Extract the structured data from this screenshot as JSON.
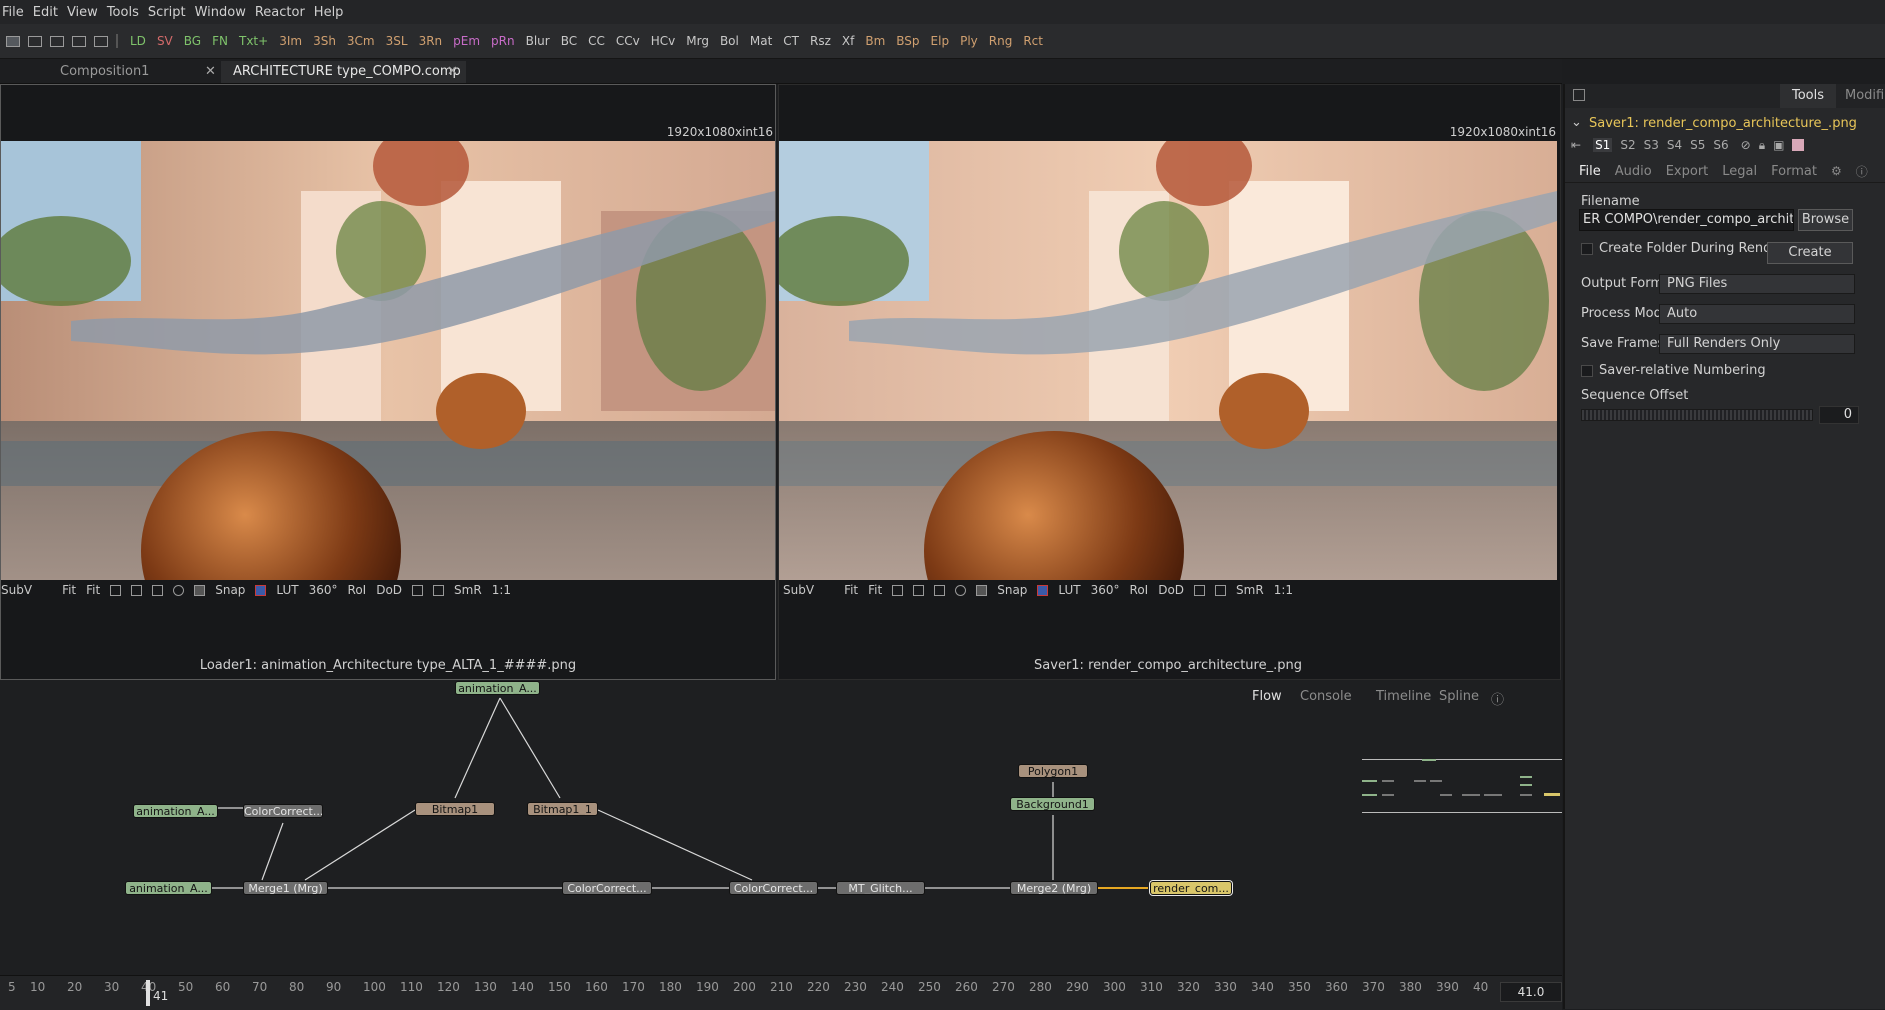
{
  "menu": [
    "File",
    "Edit",
    "View",
    "Tools",
    "Script",
    "Window",
    "Reactor",
    "Help"
  ],
  "toolbar": {
    "tools": [
      {
        "label": "LD",
        "color": "#7fc36b"
      },
      {
        "label": "SV",
        "color": "#d36a6a"
      },
      {
        "label": "BG",
        "color": "#7fc36b"
      },
      {
        "label": "FN",
        "color": "#7fc36b"
      },
      {
        "label": "Txt+",
        "color": "#7fc36b"
      },
      {
        "label": "3Im",
        "color": "#d0a070"
      },
      {
        "label": "3Sh",
        "color": "#d0a070"
      },
      {
        "label": "3Cm",
        "color": "#d0a070"
      },
      {
        "label": "3SL",
        "color": "#d0a070"
      },
      {
        "label": "3Rn",
        "color": "#d0a070"
      },
      {
        "label": "pEm",
        "color": "#c86cc8"
      },
      {
        "label": "pRn",
        "color": "#c86cc8"
      },
      {
        "label": "Blur",
        "color": "#c8c8c8"
      },
      {
        "label": "BC",
        "color": "#c8c8c8"
      },
      {
        "label": "CC",
        "color": "#c8c8c8"
      },
      {
        "label": "CCv",
        "color": "#c8c8c8"
      },
      {
        "label": "HCv",
        "color": "#c8c8c8"
      },
      {
        "label": "Mrg",
        "color": "#c8c8c8"
      },
      {
        "label": "Bol",
        "color": "#c8c8c8"
      },
      {
        "label": "Mat",
        "color": "#c8c8c8"
      },
      {
        "label": "CT",
        "color": "#c8c8c8"
      },
      {
        "label": "Rsz",
        "color": "#c8c8c8"
      },
      {
        "label": "Xf",
        "color": "#c8c8c8"
      },
      {
        "label": "Bm",
        "color": "#d0a070"
      },
      {
        "label": "BSp",
        "color": "#d0a070"
      },
      {
        "label": "Elp",
        "color": "#d0a070"
      },
      {
        "label": "Ply",
        "color": "#d0a070"
      },
      {
        "label": "Rng",
        "color": "#d0a070"
      },
      {
        "label": "Rct",
        "color": "#d0a070"
      }
    ]
  },
  "tabs": [
    {
      "label": "Composition1",
      "close": "✕"
    },
    {
      "label": "ARCHITECTURE type_COMPO.comp *",
      "close": "✕"
    }
  ],
  "viewer_left": {
    "resolution": "1920x1080xint16",
    "controls": [
      "SubV",
      "Fit",
      "Fit",
      "Snap",
      "LUT",
      "360°",
      "RoI",
      "DoD",
      "SmR",
      "1:1"
    ],
    "name": "Loader1: animation_Architecture type_ALTA_1_####.png"
  },
  "viewer_right": {
    "resolution": "1920x1080xint16",
    "controls": [
      "SubV",
      "Fit",
      "Fit",
      "Snap",
      "LUT",
      "360°",
      "RoI",
      "DoD",
      "SmR",
      "1:1"
    ],
    "name": "Saver1: render_compo_architecture_.png"
  },
  "flow_tabs": [
    "Flow",
    "Console",
    "Timeline",
    "Spline"
  ],
  "nodes": {
    "anim_top": "animation_A...",
    "anim_left": "animation_A...",
    "anim_bottom": "animation_A...",
    "cc1": "ColorCorrect...",
    "bitmap1": "Bitmap1",
    "bitmap1_1": "Bitmap1_1",
    "merge1": "Merge1  (Mrg)",
    "cc2": "ColorCorrect...",
    "cc3": "ColorCorrect...",
    "glitch": "MT_Glitch...",
    "polygon": "Polygon1",
    "background": "Background1",
    "merge2": "Merge2  (Mrg)",
    "render": "render_com..."
  },
  "timeline": {
    "ticks": [
      "5",
      "10",
      "20",
      "30",
      "40",
      "50",
      "60",
      "70",
      "80",
      "90",
      "100",
      "110",
      "120",
      "130",
      "140",
      "150",
      "160",
      "170",
      "180",
      "190",
      "200",
      "210",
      "220",
      "230",
      "240",
      "250",
      "260",
      "270",
      "280",
      "290",
      "300",
      "310",
      "320",
      "330",
      "340",
      "350",
      "360",
      "370",
      "380",
      "390",
      "40"
    ],
    "current_frame_label": "41",
    "current_time": "41.0"
  },
  "inspector": {
    "tabs": [
      "Tools",
      "Modifie"
    ],
    "tool_title": "Saver1: render_compo_architecture_.png",
    "slots": [
      "S1",
      "S2",
      "S3",
      "S4",
      "S5",
      "S6"
    ],
    "sub_tabs": [
      "File",
      "Audio",
      "Export",
      "Legal",
      "Format"
    ],
    "filename_label": "Filename",
    "filename_value": "ER COMPO\\render_compo_architecture_.png",
    "browse": "Browse",
    "create_folder": "Create Folder During Render",
    "create": "Create",
    "output_format_label": "Output Forma",
    "output_format": "PNG Files",
    "process_mode_label": "Process Mode",
    "process_mode": "Auto",
    "save_frames_label": "Save Frames",
    "save_frames": "Full Renders Only",
    "saver_numbering": "Saver-relative Numbering",
    "sequence_offset_label": "Sequence Offset",
    "sequence_offset": "0"
  }
}
